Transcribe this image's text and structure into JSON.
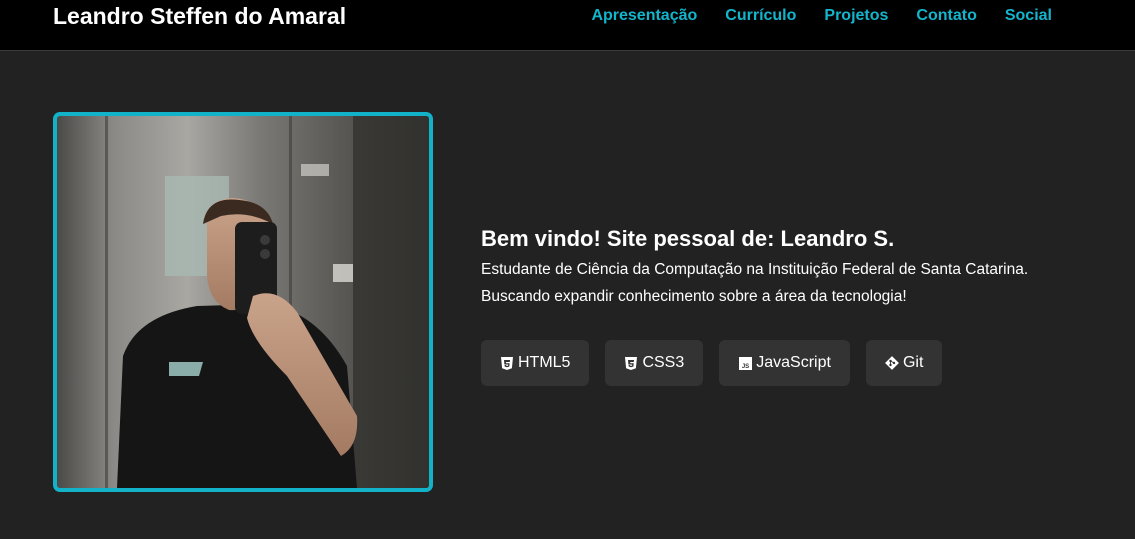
{
  "header": {
    "brand": "Leandro Steffen do Amaral",
    "nav": [
      {
        "label": "Apresentação"
      },
      {
        "label": "Currículo"
      },
      {
        "label": "Projetos"
      },
      {
        "label": "Contato"
      },
      {
        "label": "Social"
      }
    ]
  },
  "hero": {
    "title": "Bem vindo! Site pessoal de: Leandro S.",
    "description_line1": "Estudante de Ciência da Computação na Instituição Federal de Santa Catarina.",
    "description_line2": "Buscando expandir conhecimento sobre a área da tecnologia!",
    "skills": [
      {
        "label": "HTML5",
        "icon": "html5-icon"
      },
      {
        "label": "CSS3",
        "icon": "css3-icon"
      },
      {
        "label": "JavaScript",
        "icon": "javascript-icon"
      },
      {
        "label": "Git",
        "icon": "git-icon"
      }
    ]
  },
  "colors": {
    "accent": "#13b5cc",
    "header_bg": "#000000",
    "page_bg": "#222222",
    "chip_bg": "#333333"
  }
}
